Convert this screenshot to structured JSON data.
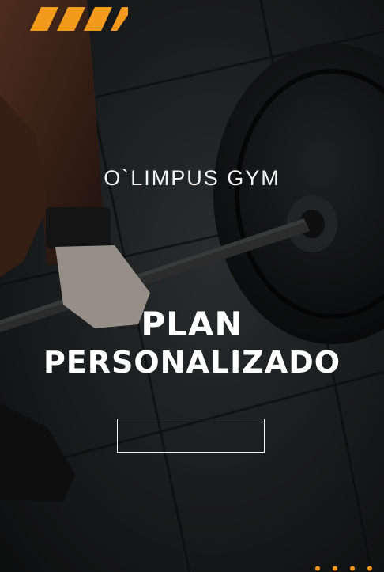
{
  "brand": {
    "name": "O`LIMPUS GYM"
  },
  "hero": {
    "headline_line1": "PLAN",
    "headline_line2": "PERSONALIZADO",
    "background": "gym-deadlift-barbell-photo"
  },
  "cta": {
    "label": ""
  },
  "colors": {
    "accent": "#f39a1d",
    "text": "#ffffff",
    "overlay": "#1b1d1f"
  },
  "icons": {
    "logo": "orange-diagonal-stripes-icon",
    "carousel": "pagination-dots-icon"
  }
}
